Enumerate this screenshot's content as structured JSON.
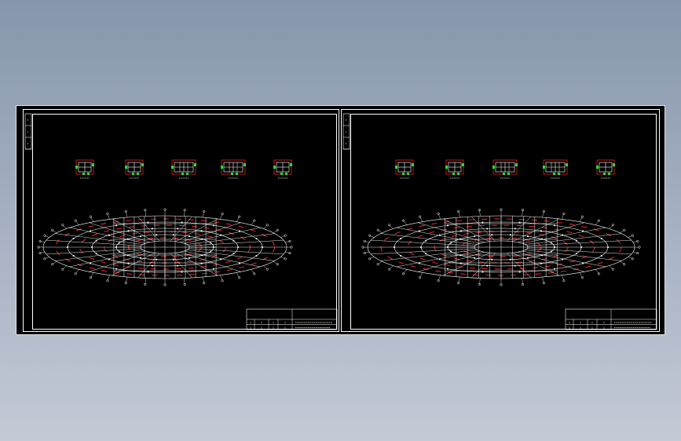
{
  "viewer": {
    "background_top": "#8796ad",
    "background_bottom": "#c4cad6",
    "canvas_color": "#000000"
  },
  "colors": {
    "line": "#ffffff",
    "accent_red": "#ff2a2a",
    "accent_green": "#22dd33"
  },
  "sheets": [
    {
      "id": "sheet-1",
      "side_labels": [
        "3",
        "1",
        "2"
      ],
      "column_details": 5,
      "plan_type": "elliptical-grid",
      "title_block": {
        "rows": [
          [
            "1",
            "1",
            "1",
            "1"
          ],
          [
            "1",
            "1",
            "1",
            "1"
          ]
        ]
      }
    },
    {
      "id": "sheet-2",
      "side_labels": [
        "3",
        "1",
        "2"
      ],
      "column_details": 5,
      "plan_type": "elliptical-grid",
      "title_block": {
        "rows": [
          [
            "1",
            "1",
            "1",
            "1"
          ],
          [
            "1",
            "1",
            "1",
            "1"
          ]
        ]
      }
    }
  ]
}
